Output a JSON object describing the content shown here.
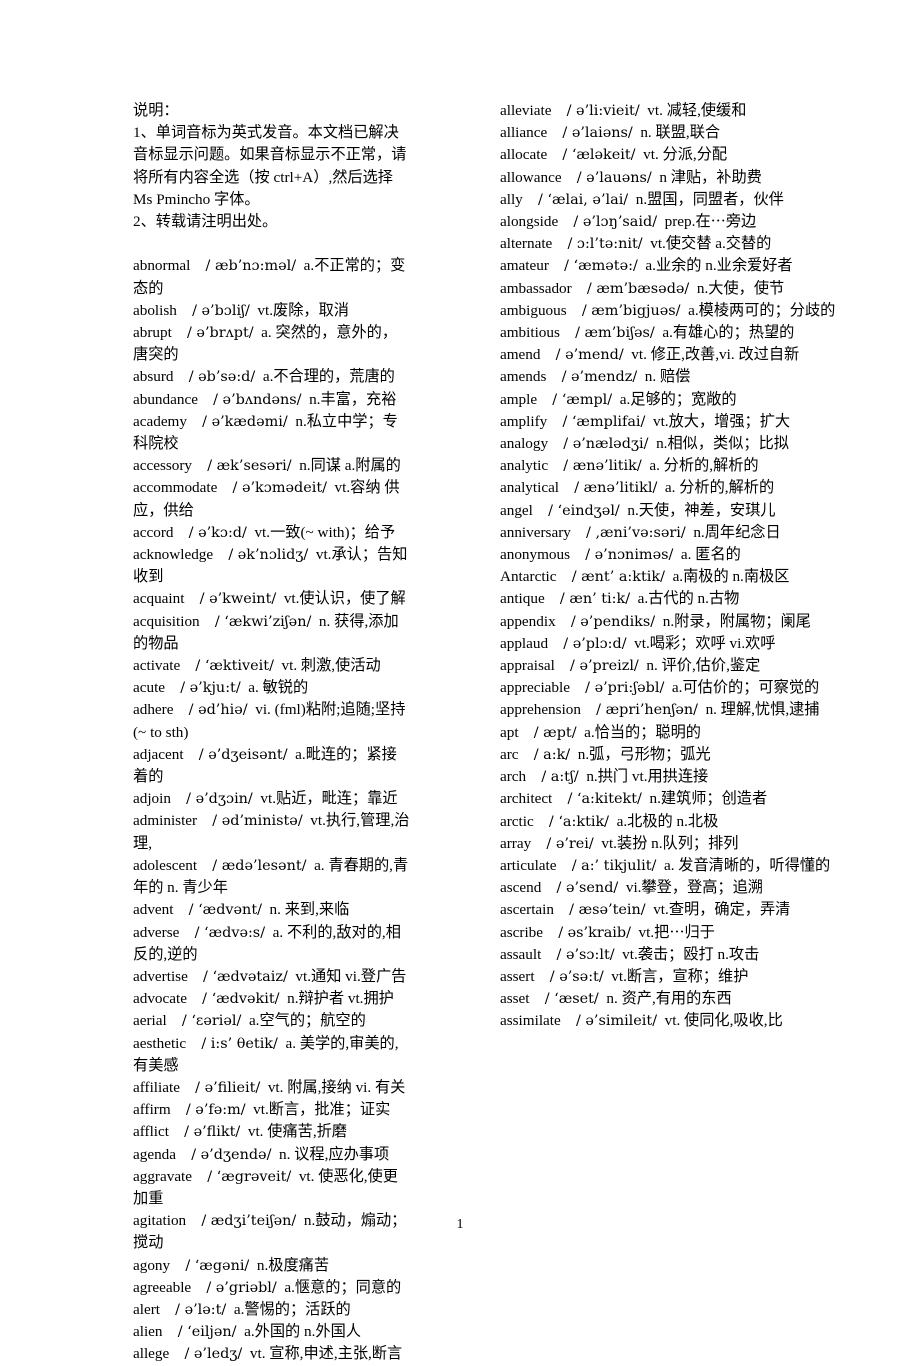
{
  "document": {
    "page_number": "1",
    "notes": {
      "heading": "说明：",
      "items": [
        "1、单词音标为英式发音。本文档已解决音标显示问题。如果音标显示不正常，请将所有内容全选（按 ctrl+A）,然后选择 Ms Pmincho 字体。",
        "2、转载请注明出处。"
      ]
    },
    "columns": [
      {
        "name": "left-column",
        "entries": [
          {
            "word": "abnormal",
            "ipa": "/ æb’nɔ:məl/",
            "definition": "a.不正常的；变态的"
          },
          {
            "word": "abolish",
            "ipa": "/ ə’bɔliʃ/",
            "definition": "vt.废除，取消"
          },
          {
            "word": "abrupt",
            "ipa": "/ ə’brʌpt/",
            "definition": "a. 突然的，意外的，唐突的"
          },
          {
            "word": "absurd",
            "ipa": "/ əb’sə:d/",
            "definition": "a.不合理的，荒唐的"
          },
          {
            "word": "abundance",
            "ipa": "/ ə’bʌndəns/",
            "definition": "n.丰富，充裕"
          },
          {
            "word": "academy",
            "ipa": "/ ə’kædəmi/",
            "definition": "n.私立中学；专科院校"
          },
          {
            "word": "accessory",
            "ipa": "/ æk’sesəri/",
            "definition": "n.同谋 a.附属的"
          },
          {
            "word": "accommodate",
            "ipa": "/ ə’kɔmədeit/",
            "definition": "vt.容纳 供应，供给"
          },
          {
            "word": "accord",
            "ipa": "/ ə’kɔ:d/",
            "definition": "vt.一致(~ with)；给予"
          },
          {
            "word": "acknowledge",
            "ipa": "/ ək’nɔlidʒ/",
            "definition": "vt.承认；告知收到"
          },
          {
            "word": "acquaint",
            "ipa": "/ ə’kweint/",
            "definition": "vt.使认识，使了解"
          },
          {
            "word": "acquisition",
            "ipa": "/ ‘ækwi’ziʃən/",
            "definition": "n. 获得,添加的物品"
          },
          {
            "word": "activate",
            "ipa": "/ ‘æktiveit/",
            "definition": "vt. 刺激,使活动"
          },
          {
            "word": "acute",
            "ipa": "/ ə’kju:t/",
            "definition": "a. 敏锐的"
          },
          {
            "word": "adhere",
            "ipa": "/ əd’hiə/",
            "definition": "vi. (fml)粘附;追随;坚持(~ to sth)"
          },
          {
            "word": "adjacent",
            "ipa": "/ ə’dʒeisənt/",
            "definition": "a.毗连的；紧接着的"
          },
          {
            "word": "adjoin",
            "ipa": "/ ə’dʒɔin/",
            "definition": "vt.贴近，毗连；靠近"
          },
          {
            "word": "administer",
            "ipa": "/ əd’ministə/",
            "definition": "vt.执行,管理,治理,"
          },
          {
            "word": "adolescent",
            "ipa": "/ ædə’lesənt/",
            "definition": "a. 青春期的,青年的 n. 青少年"
          },
          {
            "word": "advent",
            "ipa": "/ ‘ædvənt/",
            "definition": "n. 来到,来临"
          },
          {
            "word": "adverse",
            "ipa": "/ ‘ædvə:s/",
            "definition": "a. 不利的,敌对的,相反的,逆的"
          },
          {
            "word": "advertise",
            "ipa": "/ ‘ædvətaiz/",
            "definition": "vt.通知 vi.登广告"
          },
          {
            "word": "advocate",
            "ipa": "/ ‘ædvəkit/",
            "definition": "n.辩护者 vt.拥护"
          },
          {
            "word": "aerial",
            "ipa": "/ ‘ɛəriəl/",
            "definition": "a.空气的；航空的"
          },
          {
            "word": "aesthetic",
            "ipa": "/ i:s’ θetik/",
            "definition": "a. 美学的,审美的,有美感"
          },
          {
            "word": "affiliate",
            "ipa": "/ ə’filieit/",
            "definition": "vt. 附属,接纳 vi. 有关"
          },
          {
            "word": "affirm",
            "ipa": "/ ə’fə:m/",
            "definition": "vt.断言，批准；证实"
          },
          {
            "word": "afflict",
            "ipa": "/ ə’flikt/",
            "definition": "vt. 使痛苦,折磨"
          },
          {
            "word": "agenda",
            "ipa": "/ ə’dʒendə/",
            "definition": "n. 议程,应办事项"
          },
          {
            "word": "aggravate",
            "ipa": "/ ‘ægrəveit/",
            "definition": "vt. 使恶化,使更加重"
          },
          {
            "word": "agitation",
            "ipa": "/ ædʒi’teiʃən/",
            "definition": "n.鼓动，煽动；搅动"
          },
          {
            "word": "agony",
            "ipa": "/ ‘ægəni/",
            "definition": "n.极度痛苦"
          },
          {
            "word": "agreeable",
            "ipa": "/ ə’griəbl/",
            "definition": "a.惬意的；同意的"
          },
          {
            "word": "alert",
            "ipa": "/ ə’lə:t/",
            "definition": "a.警惕的；活跃的"
          },
          {
            "word": "alien",
            "ipa": "/ ‘eiljən/",
            "definition": "a.外国的 n.外国人"
          },
          {
            "word": "allege",
            "ipa": "/ ə’ledʒ/",
            "definition": "vt. 宣称,申述,主张,断言"
          }
        ]
      },
      {
        "name": "right-column",
        "entries": [
          {
            "word": "alleviate",
            "ipa": "/ ə’li:vieit/",
            "definition": "vt. 减轻,使缓和"
          },
          {
            "word": "alliance",
            "ipa": "/ ə’laiəns/",
            "definition": "n. 联盟,联合"
          },
          {
            "word": "allocate",
            "ipa": "/ ‘æləkeit/",
            "definition": "vt. 分派,分配"
          },
          {
            "word": "allowance",
            "ipa": "/ ə’lauəns/",
            "definition": "n 津贴，补助费"
          },
          {
            "word": "ally",
            "ipa": "/ ‘ælai, ə’lai/",
            "definition": "n.盟国，同盟者，伙伴"
          },
          {
            "word": "alongside",
            "ipa": "/ ə’lɔŋ’said/",
            "definition": "prep.在⋯旁边"
          },
          {
            "word": "alternate",
            "ipa": "/ ɔ:l’tə:nit/",
            "definition": "vt.使交替 a.交替的"
          },
          {
            "word": "amateur",
            "ipa": "/ ‘æmətə:/",
            "definition": "a.业余的 n.业余爱好者"
          },
          {
            "word": "ambassador",
            "ipa": "/ æm’bæsədə/",
            "definition": "n.大使，使节"
          },
          {
            "word": "ambiguous",
            "ipa": "/ æm’bigjuəs/",
            "definition": "a.模棱两可的；分歧的"
          },
          {
            "word": "ambitious",
            "ipa": "/ æm’biʃəs/",
            "definition": "a.有雄心的；热望的"
          },
          {
            "word": "amend",
            "ipa": "/ ə’mend/",
            "definition": "vt. 修正,改善,vi. 改过自新"
          },
          {
            "word": "amends",
            "ipa": "/ ə’mendz/",
            "definition": "n. 赔偿"
          },
          {
            "word": "ample",
            "ipa": "/ ‘æmpl/",
            "definition": "a.足够的；宽敞的"
          },
          {
            "word": "amplify",
            "ipa": "/ ‘æmplifai/",
            "definition": "vt.放大，增强；扩大"
          },
          {
            "word": "analogy",
            "ipa": "/ ə’nælədʒi/",
            "definition": "n.相似，类似；比拟"
          },
          {
            "word": "analytic",
            "ipa": "/ ænə’litik/",
            "definition": "a. 分析的,解析的"
          },
          {
            "word": "analytical",
            "ipa": "/ ænə’litikl/",
            "definition": "a. 分析的,解析的"
          },
          {
            "word": "angel",
            "ipa": "/ ‘eindʒəl/",
            "definition": "n.天使，神差，安琪儿"
          },
          {
            "word": "anniversary",
            "ipa": "/ ,æni’və:səri/",
            "definition": "n.周年纪念日"
          },
          {
            "word": "anonymous",
            "ipa": "/ ə’nɔniməs/",
            "definition": "a. 匿名的"
          },
          {
            "word": "Antarctic",
            "ipa": "/ ænt’ a:ktik/",
            "definition": "a.南极的 n.南极区"
          },
          {
            "word": "antique",
            "ipa": "/ æn’ ti:k/",
            "definition": "a.古代的 n.古物"
          },
          {
            "word": "appendix",
            "ipa": "/ ə’pendiks/",
            "definition": "n.附录，附属物；阑尾"
          },
          {
            "word": "applaud",
            "ipa": "/ ə’plɔ:d/",
            "definition": "vt.喝彩；欢呼 vi.欢呼"
          },
          {
            "word": "appraisal",
            "ipa": "/ ə’preizl/",
            "definition": "n. 评价,估价,鉴定"
          },
          {
            "word": "appreciable",
            "ipa": "/ ə’pri:ʃəbl/",
            "definition": "a.可估价的；可察觉的"
          },
          {
            "word": "apprehension",
            "ipa": "/ æpri’henʃən/",
            "definition": "n. 理解,忧惧,逮捕"
          },
          {
            "word": "apt",
            "ipa": "/ æpt/",
            "definition": "a.恰当的；聪明的"
          },
          {
            "word": "arc",
            "ipa": "/ a:k/",
            "definition": "n.弧，弓形物；弧光"
          },
          {
            "word": "arch",
            "ipa": "/ a:tʃ/",
            "definition": "n.拱门 vt.用拱连接"
          },
          {
            "word": "architect",
            "ipa": "/ ‘a:kitekt/",
            "definition": "n.建筑师；创造者"
          },
          {
            "word": "arctic",
            "ipa": "/ ‘a:ktik/",
            "definition": "a.北极的 n.北极"
          },
          {
            "word": "array",
            "ipa": "/ ə’rei/",
            "definition": "vt.装扮 n.队列；排列"
          },
          {
            "word": "articulate",
            "ipa": "/ a:’ tikjulit/",
            "definition": "a. 发音清晰的，听得懂的"
          },
          {
            "word": "ascend",
            "ipa": "/ ə’send/",
            "definition": "vi.攀登，登高；追溯"
          },
          {
            "word": "ascertain",
            "ipa": "/ æsə’tein/",
            "definition": "vt.查明，确定，弄清"
          },
          {
            "word": "ascribe",
            "ipa": "/ əs’kraib/",
            "definition": "vt.把⋯归于"
          },
          {
            "word": "assault",
            "ipa": "/ ə’sɔ:lt/",
            "definition": "vt.袭击；殴打 n.攻击"
          },
          {
            "word": "assert",
            "ipa": "/ ə’sə:t/",
            "definition": "vt.断言，宣称；维护"
          },
          {
            "word": "asset",
            "ipa": "/ ‘æset/",
            "definition": "n. 资产,有用的东西"
          },
          {
            "word": "assimilate",
            "ipa": "/ ə’simileit/",
            "definition": "vt. 使同化,吸收,比"
          }
        ]
      }
    ]
  }
}
